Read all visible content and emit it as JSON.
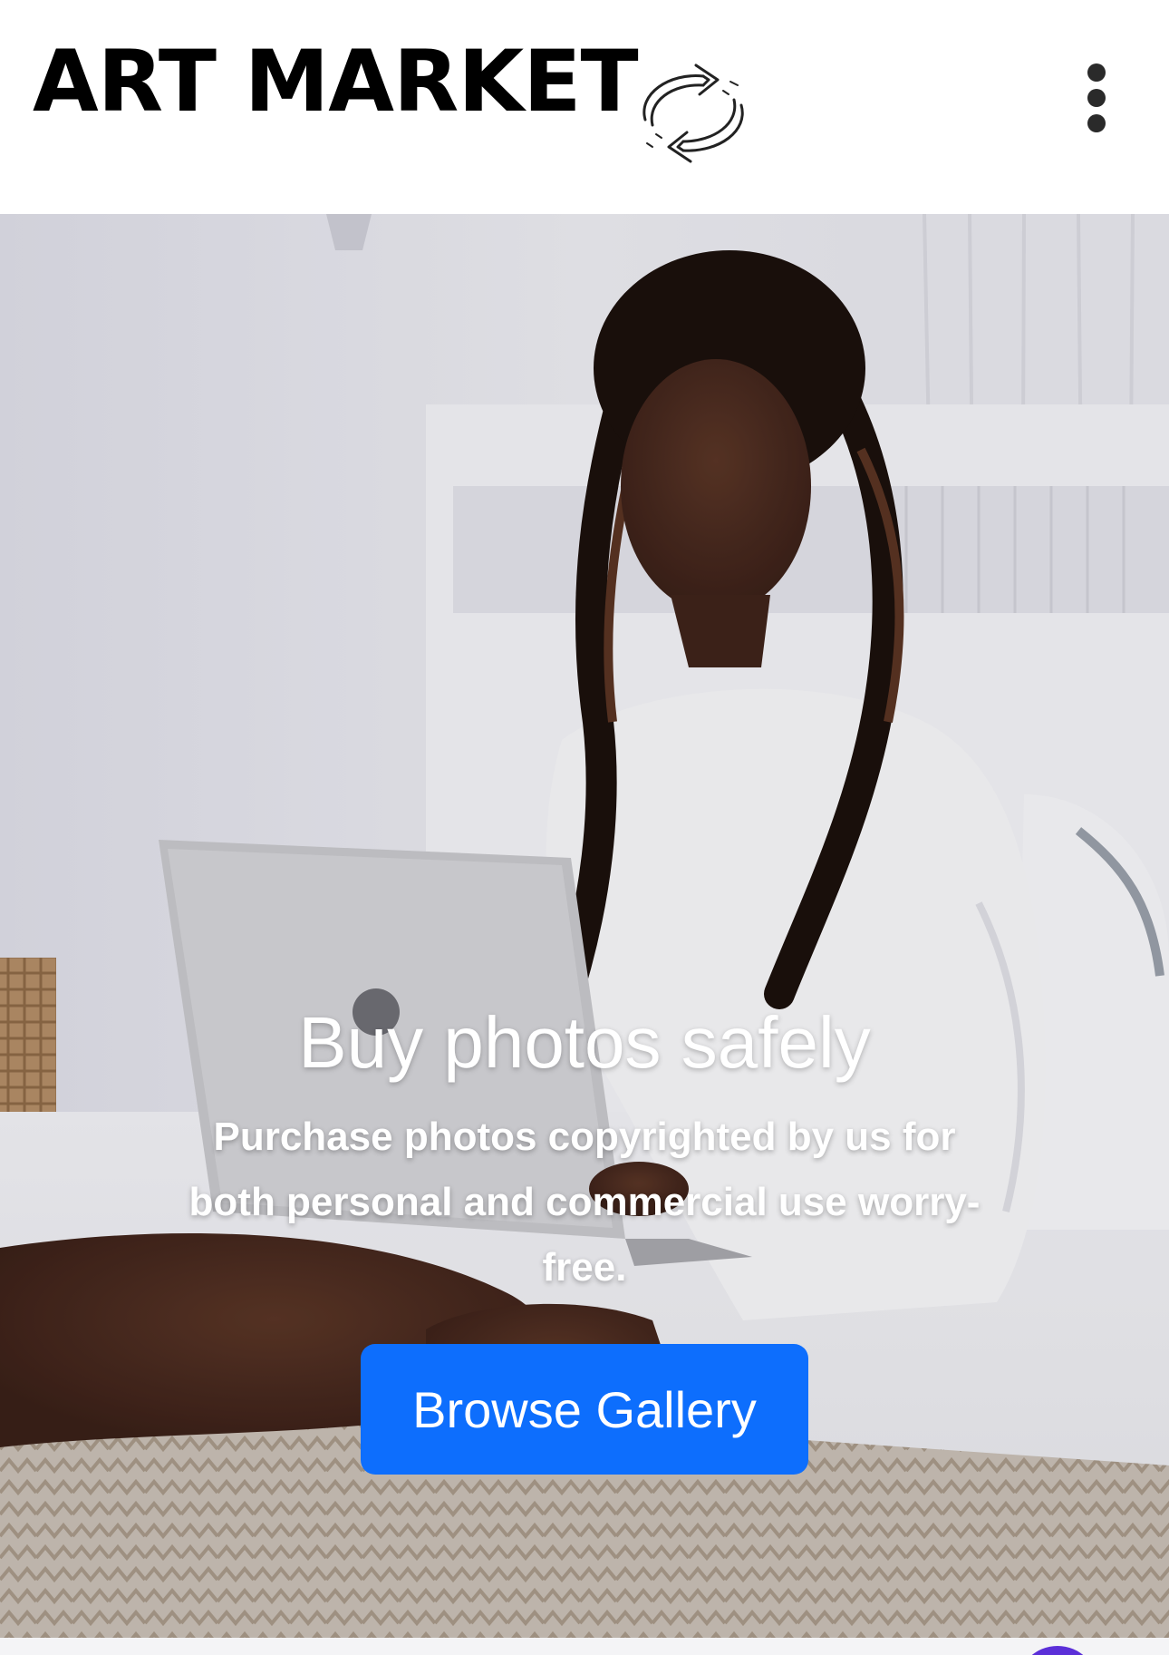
{
  "header": {
    "brand": "ART MARKET",
    "logo_icon": "sync-arrows-icon",
    "menu_icon": "kebab-menu-icon"
  },
  "hero": {
    "title": "Buy photos safely",
    "subtitle": "Purchase photos copyrighted by us for both personal and commercial use worry-free.",
    "cta_label": "Browse Gallery",
    "image_icon": "woman-with-laptop-photo"
  },
  "colors": {
    "cta_background": "#0d6efd",
    "cta_text": "#ffffff",
    "brand_text": "#000000",
    "fab_peek": "#5b2fd8"
  }
}
